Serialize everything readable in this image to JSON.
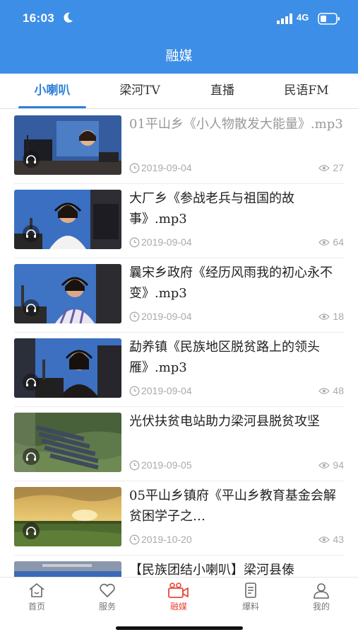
{
  "status_bar": {
    "time": "16:03",
    "network": "4G"
  },
  "header": {
    "title": "融媒"
  },
  "tabs": [
    {
      "label": "小喇叭",
      "active": true
    },
    {
      "label": "梁河TV",
      "active": false
    },
    {
      "label": "直播",
      "active": false
    },
    {
      "label": "民语FM",
      "active": false
    }
  ],
  "articles": [
    {
      "title": "01平山乡《小人物散发大能量》.mp3",
      "date": "2019-09-04",
      "views": "27",
      "read": true
    },
    {
      "title": "大厂乡《参战老兵与祖国的故事》.mp3",
      "date": "2019-09-04",
      "views": "64",
      "read": false
    },
    {
      "title": "曩宋乡政府《经历风雨我的初心永不变》.mp3",
      "date": "2019-09-04",
      "views": "18",
      "read": false
    },
    {
      "title": "勐养镇《民族地区脱贫路上的领头雁》.mp3",
      "date": "2019-09-04",
      "views": "48",
      "read": false
    },
    {
      "title": "光伏扶贫电站助力梁河县脱贫攻坚",
      "date": "2019-09-05",
      "views": "94",
      "read": false
    },
    {
      "title": "05平山乡镇府《平山乡教育基金会解贫困学子之…",
      "date": "2019-10-20",
      "views": "43",
      "read": false
    },
    {
      "title": "【民族团结小喇叭】梁河县傣",
      "date": "",
      "views": "",
      "read": false
    }
  ],
  "bottom_nav": [
    {
      "label": "首页",
      "icon": "home-icon",
      "active": false
    },
    {
      "label": "服务",
      "icon": "heart-icon",
      "active": false
    },
    {
      "label": "融媒",
      "icon": "video-camera-icon",
      "active": true
    },
    {
      "label": "爆料",
      "icon": "document-icon",
      "active": false
    },
    {
      "label": "我的",
      "icon": "person-icon",
      "active": false
    }
  ],
  "colors": {
    "header_bg": "#3d8ee6",
    "accent": "#2f80d8",
    "nav_active": "#e9453a",
    "meta_text": "#aaaaaa"
  }
}
